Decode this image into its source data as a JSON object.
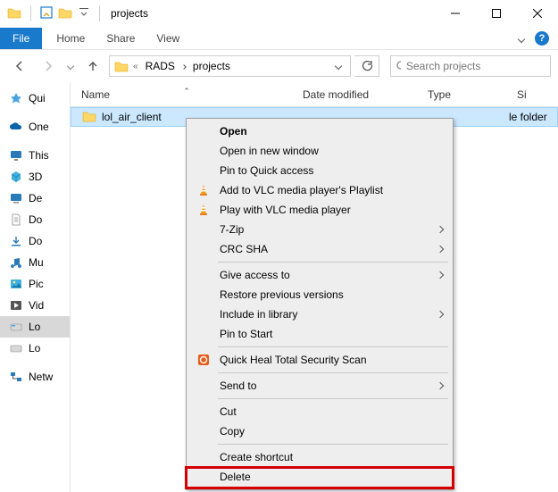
{
  "window": {
    "title": "projects"
  },
  "ribbon": {
    "file": "File",
    "tabs": [
      "Home",
      "Share",
      "View"
    ]
  },
  "breadcrumb": {
    "items": [
      "RADS",
      "projects"
    ]
  },
  "search": {
    "placeholder": "Search projects"
  },
  "columns": {
    "name": "Name",
    "date": "Date modified",
    "type": "Type",
    "size": "Si"
  },
  "navpane": {
    "quick": "Qui",
    "onedrive": "One",
    "thispc": "This",
    "items": [
      "3D",
      "De",
      "Do",
      "Do",
      "Mu",
      "Pic",
      "Vid",
      "Lo",
      "Lo"
    ],
    "network": "Netw"
  },
  "rows": [
    {
      "name": "lol_air_client",
      "type": "le folder"
    }
  ],
  "context_menu": {
    "items": [
      {
        "label": "Open",
        "bold": true
      },
      {
        "label": "Open in new window"
      },
      {
        "label": "Pin to Quick access"
      },
      {
        "label": "Add to VLC media player's Playlist",
        "icon": "vlc"
      },
      {
        "label": "Play with VLC media player",
        "icon": "vlc"
      },
      {
        "label": "7-Zip",
        "submenu": true
      },
      {
        "label": "CRC SHA",
        "submenu": true
      },
      {
        "sep": true
      },
      {
        "label": "Give access to",
        "submenu": true
      },
      {
        "label": "Restore previous versions"
      },
      {
        "label": "Include in library",
        "submenu": true
      },
      {
        "label": "Pin to Start"
      },
      {
        "sep": true
      },
      {
        "label": "Quick Heal Total Security Scan",
        "icon": "qh"
      },
      {
        "sep": true
      },
      {
        "label": "Send to",
        "submenu": true
      },
      {
        "sep": true
      },
      {
        "label": "Cut"
      },
      {
        "label": "Copy"
      },
      {
        "sep": true
      },
      {
        "label": "Create shortcut"
      },
      {
        "label": "Delete",
        "highlight": true
      }
    ]
  }
}
